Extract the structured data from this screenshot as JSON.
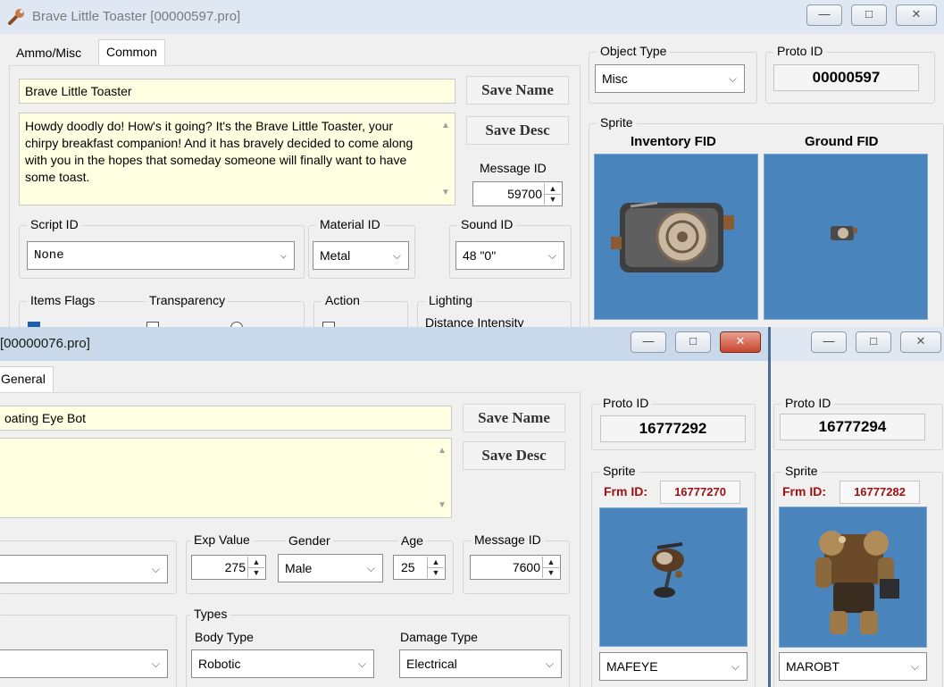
{
  "icons": {
    "app": "wrench-icon",
    "minimize": "minimize-icon",
    "maximize": "maximize-icon",
    "close": "close-icon"
  },
  "win_buttons": {
    "minimize": "—",
    "maximize": "□",
    "close": "✕"
  },
  "scroll": {
    "up": "▲",
    "down": "▼"
  },
  "spin": {
    "up": "▲",
    "down": "▼"
  },
  "chevron": "⌵",
  "toaster": {
    "title": "Brave Little Toaster [00000597.pro]",
    "tabs": [
      "Ammo/Misc",
      "Common"
    ],
    "name_value": "Brave Little Toaster",
    "save_name": "Save Name",
    "save_desc": "Save Desc",
    "description": "Howdy doodly do! How's it going? It's the Brave Little Toaster, your chirpy breakfast companion! And it has bravely decided to come along with you in the hopes that someday someone will finally want to have some toast.",
    "message_id_label": "Message ID",
    "message_id": "59700",
    "script_id_label": "Script ID",
    "script_id": "None",
    "material_id_label": "Material ID",
    "material_id": "Metal",
    "sound_id_label": "Sound ID",
    "sound_id": "48 \"0\"",
    "items_flags_label": "Items Flags",
    "transparency_label": "Transparency",
    "action_label": "Action",
    "lighting_label": "Lighting",
    "lighting_sub": "Distance   Intensity",
    "object_type_label": "Object Type",
    "object_type": "Misc",
    "proto_id_label": "Proto ID",
    "proto_id": "00000597",
    "sprite_label": "Sprite",
    "inventory_fid_label": "Inventory FID",
    "ground_fid_label": "Ground FID"
  },
  "eyebot": {
    "title": "[00000076.pro]",
    "tab": "General",
    "name_value": "oating Eye Bot",
    "save_name": "Save Name",
    "save_desc": "Save Desc",
    "exp_value_label": "Exp Value",
    "exp_value": "275",
    "gender_label": "Gender",
    "gender": "Male",
    "age_label": "Age",
    "age": "25",
    "message_id_label": "Message ID",
    "message_id": "7600",
    "types_label": "Types",
    "body_type_label": "Body Type",
    "body_type": "Robotic",
    "damage_type_label": "Damage Type",
    "damage_type": "Electrical",
    "proto_id_label": "Proto ID",
    "proto_id": "16777292",
    "sprite_label": "Sprite",
    "frm_id_label": "Frm ID:",
    "frm_id": "16777270",
    "sprite_name": "MAFEYE"
  },
  "robot": {
    "proto_id_label": "Proto ID",
    "proto_id": "16777294",
    "sprite_label": "Sprite",
    "frm_id_label": "Frm ID:",
    "frm_id": "16777282",
    "sprite_name": "MAROBT"
  }
}
